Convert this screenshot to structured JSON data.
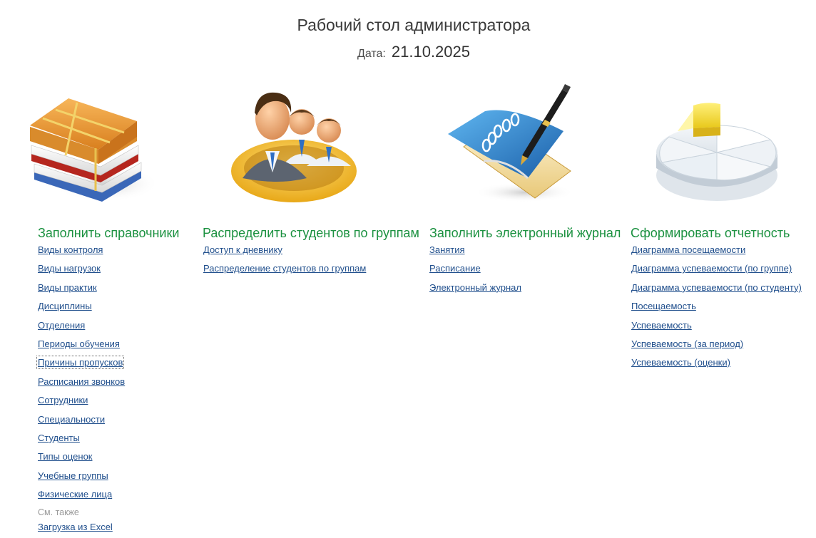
{
  "header": {
    "title": "Рабочий стол администратора",
    "date_label": "Дата:",
    "date_value": "21.10.2025"
  },
  "sections": [
    {
      "title": "Заполнить справочники",
      "icon": "books-icon",
      "links": [
        "Виды контроля",
        "Виды нагрузок",
        "Виды практик",
        "Дисциплины",
        "Отделения",
        "Периоды обучения",
        "Причины пропусков",
        "Расписания звонков",
        "Сотрудники",
        "Специальности",
        "Студенты",
        "Типы оценок",
        "Учебные группы",
        "Физические лица"
      ],
      "see_also_label": "См. также",
      "see_also_links": [
        "Загрузка из Excel"
      ]
    },
    {
      "title": "Распределить студентов по группам",
      "icon": "people-group-icon",
      "links": [
        "Доступ к дневнику",
        "Распределение студентов по группам"
      ]
    },
    {
      "title": "Заполнить электронный журнал",
      "icon": "notebook-pen-icon",
      "links": [
        "Занятия",
        "Расписание",
        "Электронный журнал"
      ]
    },
    {
      "title": "Сформировать отчетность",
      "icon": "pie-chart-icon",
      "links": [
        "Диаграмма посещаемости",
        "Диаграмма успеваемости (по группе)",
        "Диаграмма успеваемости (по студенту)",
        "Посещаемость",
        "Успеваемость",
        "Успеваемость (за период)",
        "Успеваемость (оценки)"
      ]
    }
  ],
  "colors": {
    "section_title": "#1b9140",
    "link": "#1f4e8c",
    "muted": "#9a9a9a"
  }
}
